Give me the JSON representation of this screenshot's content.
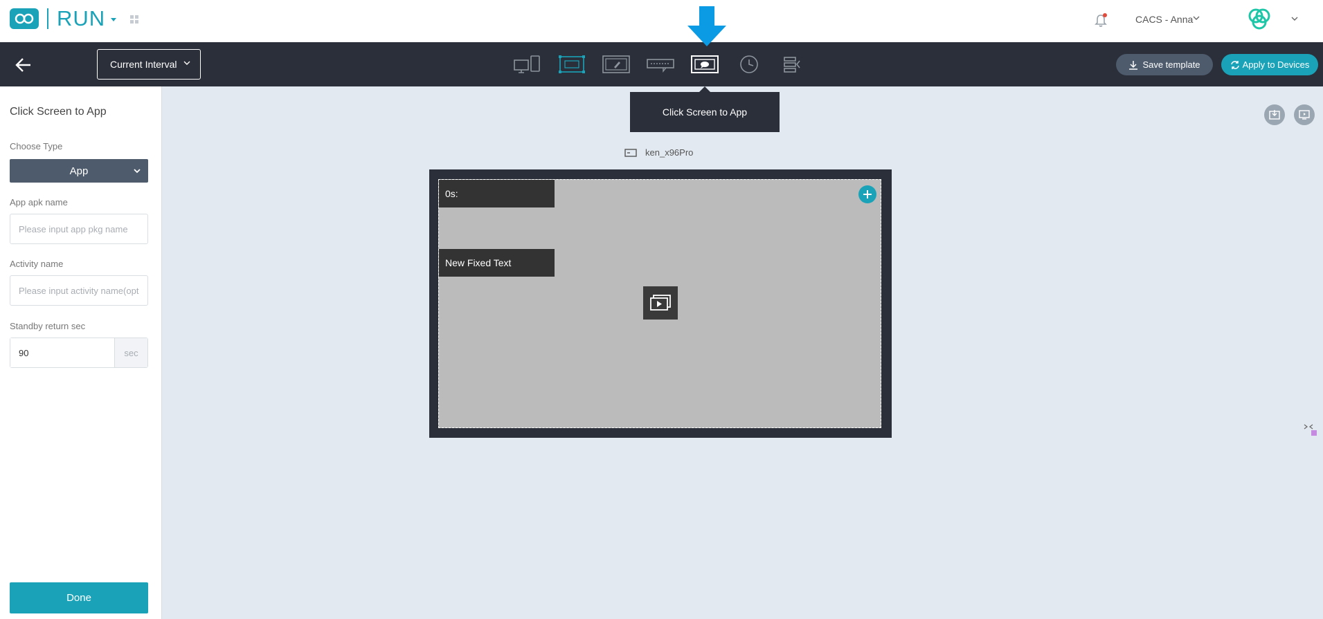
{
  "header": {
    "logo_text": "RUN",
    "user_label": "CACS - Anna"
  },
  "toolbar": {
    "interval_label": "Current Interval",
    "tools": [
      {
        "icon": "devices-icon",
        "active": false
      },
      {
        "icon": "text-scroll-icon",
        "active": false,
        "accent": true
      },
      {
        "icon": "edit-frame-icon",
        "active": false
      },
      {
        "icon": "marquee-icon",
        "active": false
      },
      {
        "icon": "screen-app-icon",
        "active": true
      },
      {
        "icon": "clock-icon",
        "active": false
      },
      {
        "icon": "layers-icon",
        "active": false
      }
    ],
    "save_label": "Save template",
    "apply_label": "Apply to Devices"
  },
  "tooltip": {
    "text": "Click Screen to App"
  },
  "panel": {
    "title": "Click Screen to App",
    "choose_type_label": "Choose Type",
    "type_value": "App",
    "apk_label": "App apk name",
    "apk_placeholder": "Please input app pkg name",
    "activity_label": "Activity name",
    "activity_placeholder": "Please input activity name(optional)",
    "standby_label": "Standby return sec",
    "standby_value": "90",
    "standby_unit": "sec",
    "done_label": "Done"
  },
  "canvas": {
    "device_name": "ken_x96Pro",
    "blocks": [
      {
        "text": "0s:"
      },
      {
        "text": "New Fixed Text"
      }
    ]
  },
  "colors": {
    "accent": "#1aa3b8",
    "toolbar_bg": "#2b2f3a",
    "arrow_blue": "#0a9be4",
    "workspace_bg": "#e2e9f0"
  }
}
